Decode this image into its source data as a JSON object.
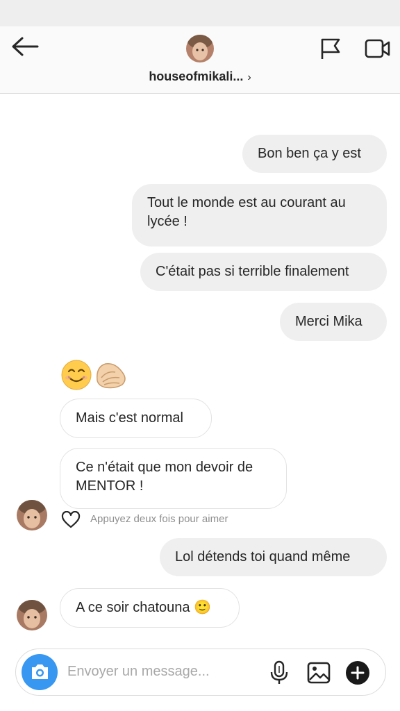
{
  "header": {
    "username": "houseofmikali...",
    "chevron": "›",
    "icons": [
      "back-arrow-icon",
      "avatar",
      "flag-icon",
      "video-call-icon"
    ]
  },
  "messages": [
    {
      "direction": "out",
      "text": "Bon ben ça y est"
    },
    {
      "direction": "out",
      "text": "Tout le monde est au courant au lycée !"
    },
    {
      "direction": "out",
      "text": "C'était pas si terrible finalement"
    },
    {
      "direction": "out",
      "text": "Merci Mika"
    },
    {
      "direction": "in",
      "text": "Mais c'est normal"
    },
    {
      "direction": "in",
      "text": "Ce n'était que mon devoir de MENTOR !"
    },
    {
      "direction": "out",
      "text": "Lol détends toi quand même"
    },
    {
      "direction": "in",
      "text": "A ce soir chatouna 🙂"
    }
  ],
  "emoji_message": {
    "icons": [
      "smiling-face-emoji",
      "clapping-hands-emoji"
    ]
  },
  "like_hint": "Appuyez deux fois pour aimer",
  "composer": {
    "placeholder": "Envoyer un message...",
    "icons": [
      "camera-icon",
      "microphone-icon",
      "gallery-icon",
      "plus-icon"
    ]
  },
  "colors": {
    "accent": "#3897f0",
    "outgoing_bubble": "#efefef",
    "incoming_border": "#e2e2e2",
    "hint": "#8e8e8e"
  }
}
